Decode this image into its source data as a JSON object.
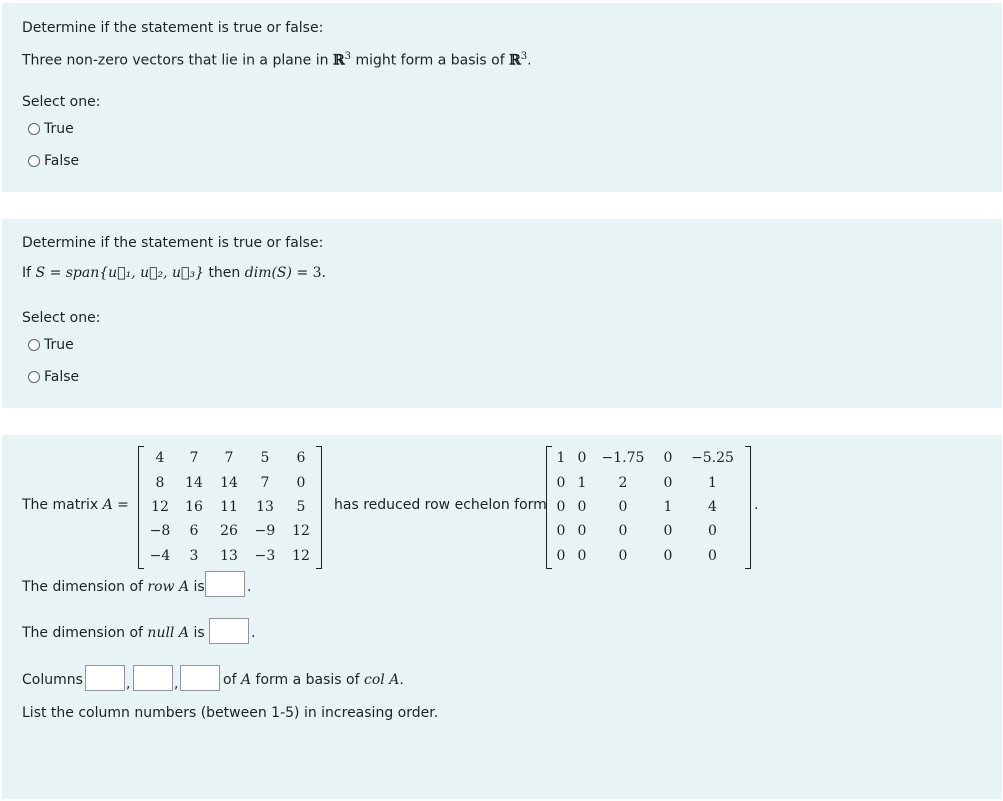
{
  "q1": {
    "prompt": "Determine if the statement is true or false:",
    "statement_pre": "Three non-zero vectors that lie in a plane in",
    "set_R": "ℝ",
    "exp": "3",
    "statement_mid": "might form a basis of",
    "end": ".",
    "select_label": "Select one:",
    "options": [
      "True",
      "False"
    ]
  },
  "q2": {
    "prompt": "Determine if the statement is true or false:",
    "if": "If",
    "S": "S",
    "eq": "=",
    "span": "span",
    "vectors": "{u⃗₁, u⃗₂, u⃗₃}",
    "then": "then",
    "dim_expr": "dim(S)",
    "eq2": "=",
    "value": "3.",
    "select_label": "Select one:",
    "options": [
      "True",
      "False"
    ]
  },
  "q3": {
    "matrix_label": "The matrix",
    "A": "A",
    "eq": "=",
    "matrix_A": [
      [
        "4",
        "7",
        "7",
        "5",
        "6"
      ],
      [
        "8",
        "14",
        "14",
        "7",
        "0"
      ],
      [
        "12",
        "16",
        "11",
        "13",
        "5"
      ],
      [
        "−8",
        "6",
        "26",
        "−9",
        "12"
      ],
      [
        "−4",
        "3",
        "13",
        "−3",
        "12"
      ]
    ],
    "rref_label": "has reduced row echelon form",
    "matrix_R": [
      [
        "1",
        "0",
        "−1.75",
        "0",
        "−5.25"
      ],
      [
        "0",
        "1",
        "2",
        "0",
        "1"
      ],
      [
        "0",
        "0",
        "0",
        "1",
        "4"
      ],
      [
        "0",
        "0",
        "0",
        "0",
        "0"
      ],
      [
        "0",
        "0",
        "0",
        "0",
        "0"
      ]
    ],
    "period": ".",
    "row_text": "The dimension of",
    "row_term": "row A",
    "is": "is",
    "null_text": "The dimension of",
    "null_term": "null A",
    "columns_label": "Columns",
    "comma": ",",
    "basis_pre": "of",
    "basis_A": "A",
    "basis_mid": "form a basis of",
    "basis_term": "col A",
    "basis_end": ".",
    "instructions": "List the column numbers (between 1-5) in increasing order."
  }
}
